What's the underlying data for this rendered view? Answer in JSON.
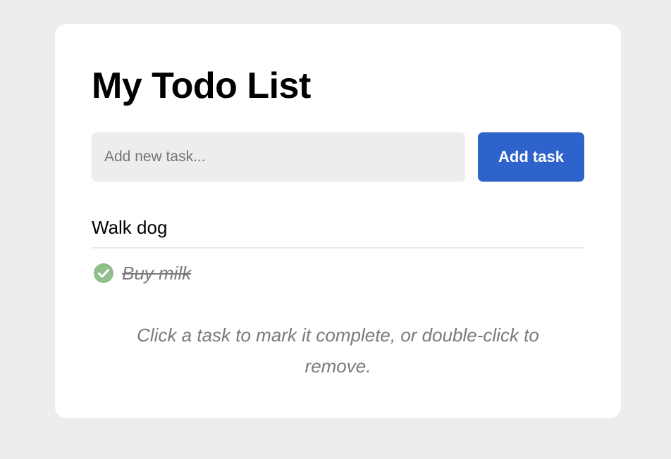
{
  "title": "My Todo List",
  "add_form": {
    "input_value": "",
    "input_placeholder": "Add new task...",
    "button_label": "Add task"
  },
  "tasks": [
    {
      "label": "Walk dog",
      "completed": false
    },
    {
      "label": "Buy milk",
      "completed": true
    }
  ],
  "hint": "Click a task to mark it complete, or double-click to remove.",
  "icons": {
    "completed": "check-circle-icon"
  },
  "colors": {
    "accent": "#2f63cc",
    "completed_check": "#8fbf8a",
    "muted_text": "#7a7a7a"
  }
}
